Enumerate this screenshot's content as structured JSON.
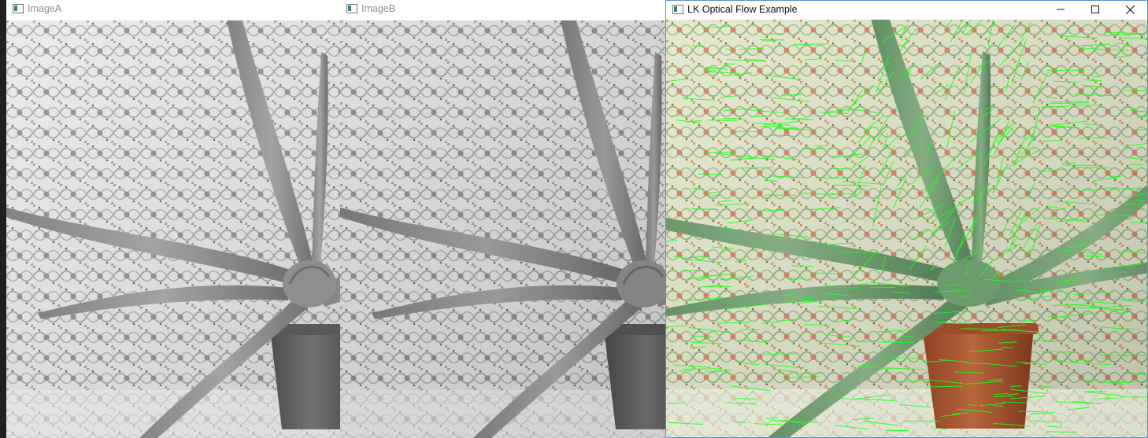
{
  "windows": {
    "image_a": {
      "title": "ImageA"
    },
    "image_b": {
      "title": "ImageB"
    },
    "flow": {
      "title": "LK Optical Flow Example"
    }
  },
  "icons": {
    "app": "opencv-window-icon",
    "minimize": "minimize-icon",
    "maximize": "maximize-icon",
    "close": "close-icon"
  },
  "colors": {
    "flow_vectors": "#1aff1a",
    "active_border": "#5b8fd0",
    "pot": "#a8552f"
  }
}
